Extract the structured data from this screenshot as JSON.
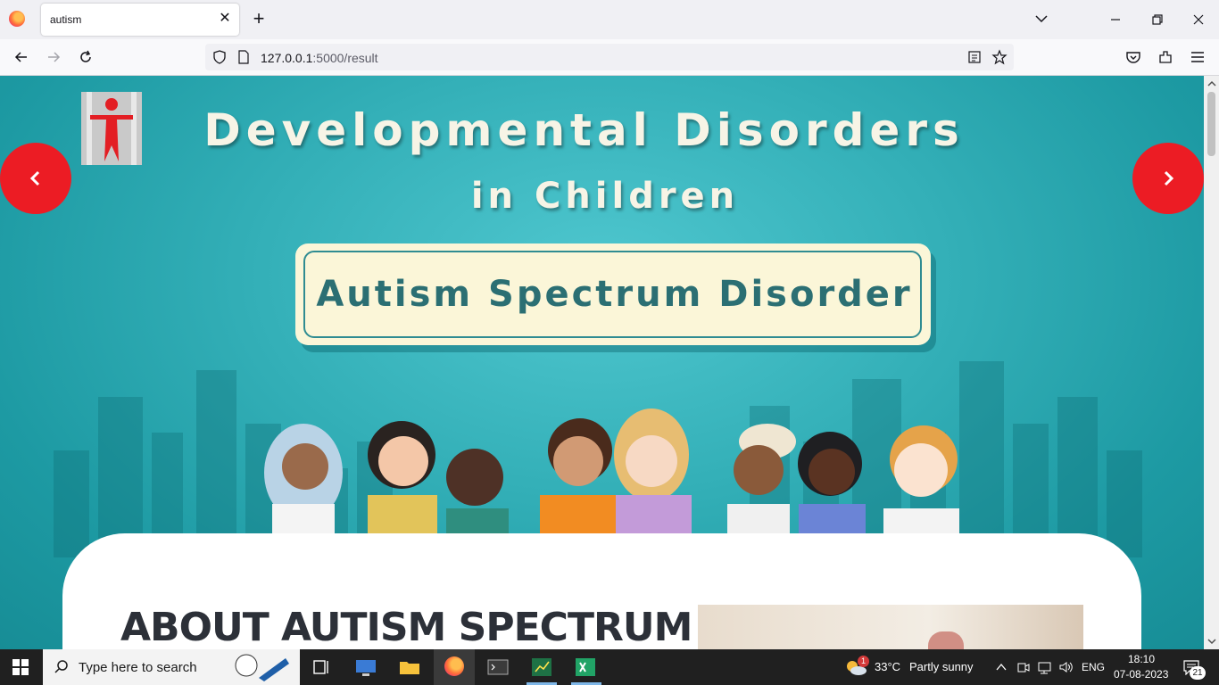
{
  "browser": {
    "tab_title": "autism",
    "url_host": "127.0.0.1",
    "url_path": ":5000/result"
  },
  "hero": {
    "title_line1": "Developmental Disorders",
    "title_line2": "in Children",
    "badge": "Autism Spectrum Disorder",
    "accent_color": "#ec1c24",
    "background_color": "#34b0b8"
  },
  "content": {
    "heading": "ABOUT AUTISM SPECTRUM"
  },
  "taskbar": {
    "search_placeholder": "Type here to search",
    "weather_temp": "33°C",
    "weather_desc": "Partly sunny",
    "weather_badge": "1",
    "language": "ENG",
    "time": "18:10",
    "date": "07-08-2023",
    "notification_count": "21"
  }
}
